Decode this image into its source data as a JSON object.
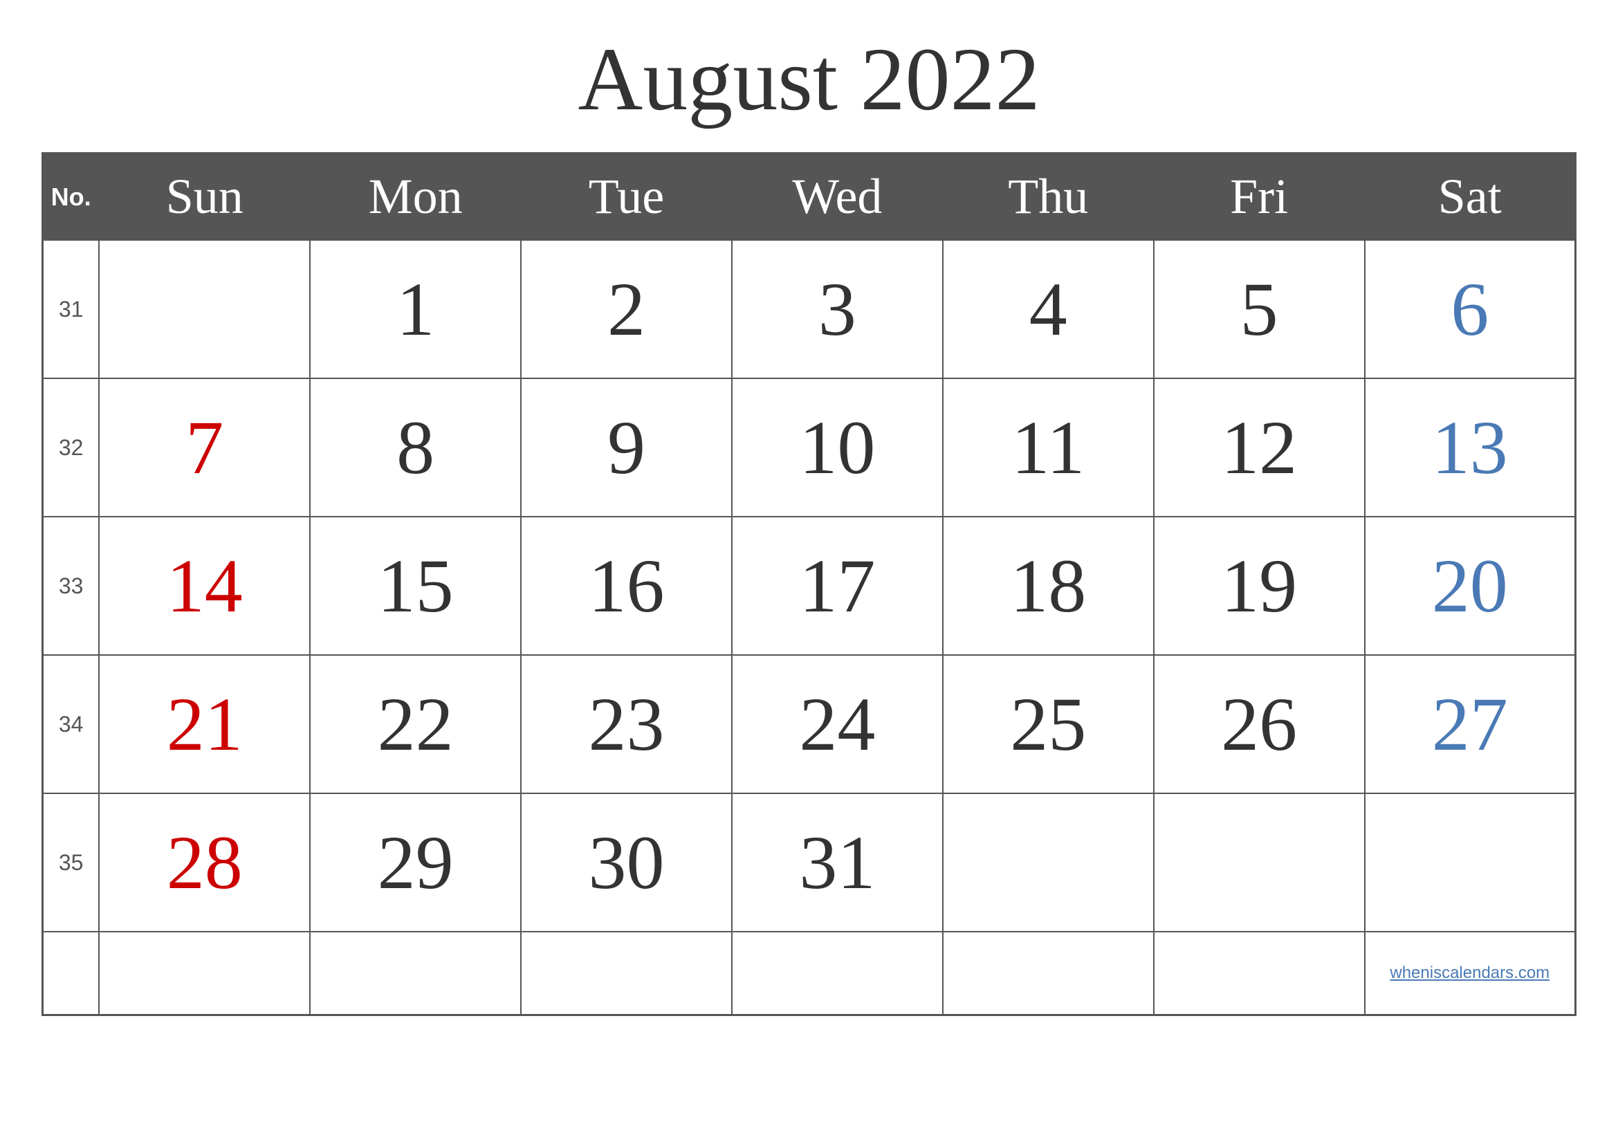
{
  "title": "August 2022",
  "header": {
    "no_label": "No.",
    "days": [
      "Sun",
      "Mon",
      "Tue",
      "Wed",
      "Thu",
      "Fri",
      "Sat"
    ]
  },
  "weeks": [
    {
      "week_num": "31",
      "days": [
        {
          "date": "",
          "color": "empty"
        },
        {
          "date": "1",
          "color": "black"
        },
        {
          "date": "2",
          "color": "black"
        },
        {
          "date": "3",
          "color": "black"
        },
        {
          "date": "4",
          "color": "black"
        },
        {
          "date": "5",
          "color": "black"
        },
        {
          "date": "6",
          "color": "blue"
        }
      ]
    },
    {
      "week_num": "32",
      "days": [
        {
          "date": "7",
          "color": "red"
        },
        {
          "date": "8",
          "color": "black"
        },
        {
          "date": "9",
          "color": "black"
        },
        {
          "date": "10",
          "color": "black"
        },
        {
          "date": "11",
          "color": "black"
        },
        {
          "date": "12",
          "color": "black"
        },
        {
          "date": "13",
          "color": "blue"
        }
      ]
    },
    {
      "week_num": "33",
      "days": [
        {
          "date": "14",
          "color": "red"
        },
        {
          "date": "15",
          "color": "black"
        },
        {
          "date": "16",
          "color": "black"
        },
        {
          "date": "17",
          "color": "black"
        },
        {
          "date": "18",
          "color": "black"
        },
        {
          "date": "19",
          "color": "black"
        },
        {
          "date": "20",
          "color": "blue"
        }
      ]
    },
    {
      "week_num": "34",
      "days": [
        {
          "date": "21",
          "color": "red"
        },
        {
          "date": "22",
          "color": "black"
        },
        {
          "date": "23",
          "color": "black"
        },
        {
          "date": "24",
          "color": "black"
        },
        {
          "date": "25",
          "color": "black"
        },
        {
          "date": "26",
          "color": "black"
        },
        {
          "date": "27",
          "color": "blue"
        }
      ]
    },
    {
      "week_num": "35",
      "days": [
        {
          "date": "28",
          "color": "red"
        },
        {
          "date": "29",
          "color": "black"
        },
        {
          "date": "30",
          "color": "black"
        },
        {
          "date": "31",
          "color": "black"
        },
        {
          "date": "",
          "color": "empty"
        },
        {
          "date": "",
          "color": "empty"
        },
        {
          "date": "",
          "color": "empty"
        }
      ]
    }
  ],
  "watermark": "wheniscalendars.com"
}
